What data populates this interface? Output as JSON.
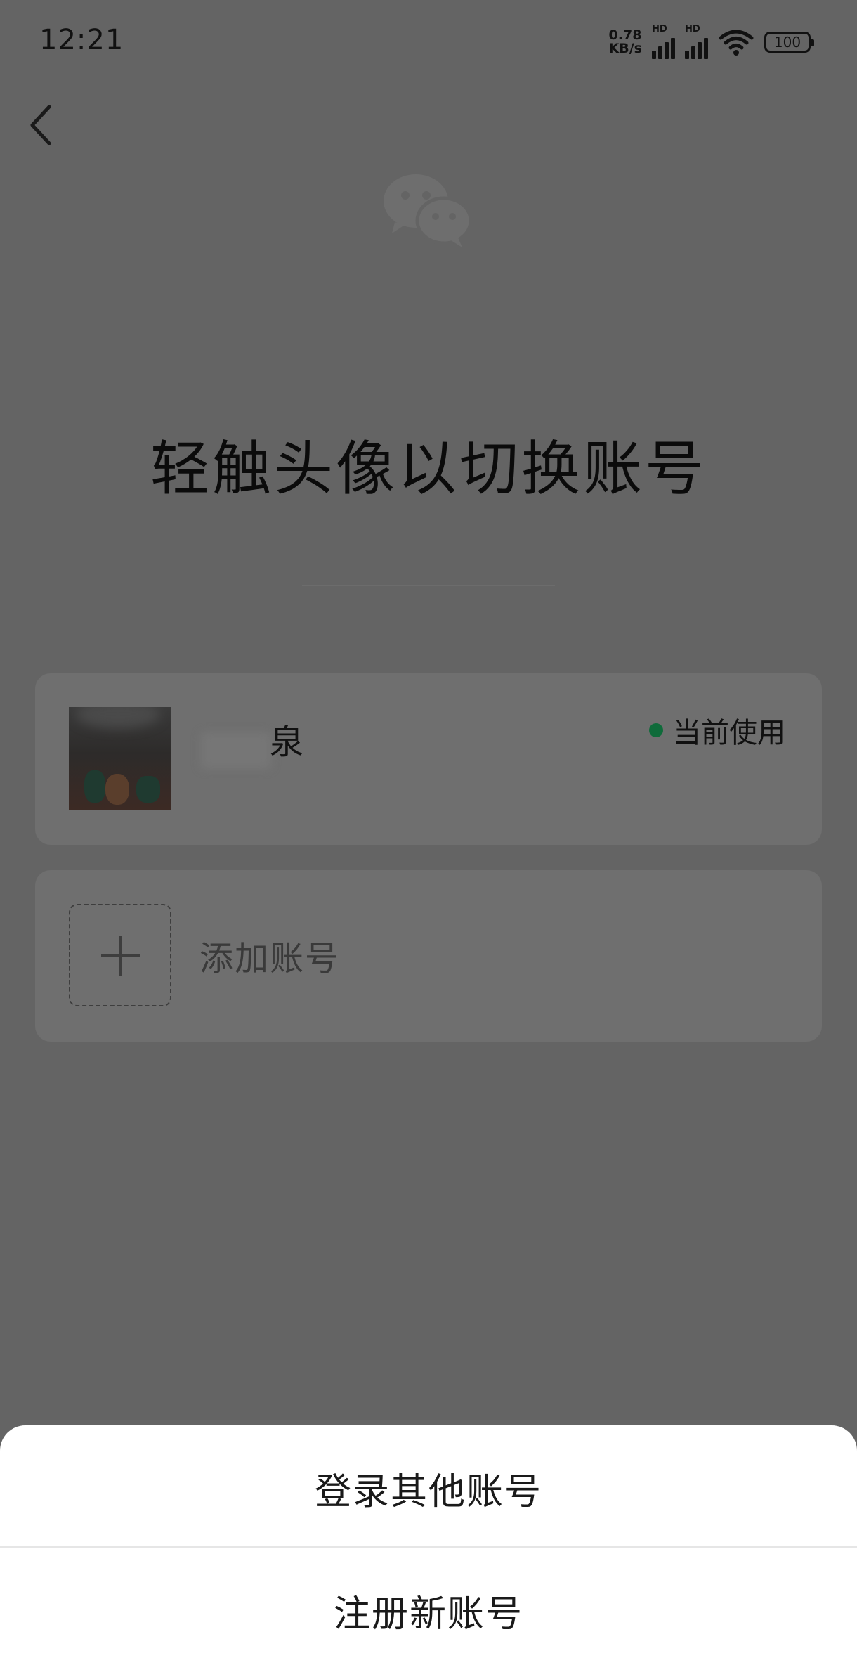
{
  "status_bar": {
    "time": "12:21",
    "net_speed_value": "0.78",
    "net_speed_unit": "KB/s",
    "signal1_label": "HD",
    "signal2_label": "HD",
    "battery": "100"
  },
  "header": {
    "back_icon": "chevron-left-icon",
    "logo_icon": "wechat-logo-icon"
  },
  "title": "轻触头像以切换账号",
  "accounts": [
    {
      "name": "泉",
      "status_label": "当前使用",
      "status_color": "#0f6b3a"
    }
  ],
  "add_account": {
    "label": "添加账号",
    "icon": "plus-icon"
  },
  "bottom_sheet": {
    "login_other": "登录其他账号",
    "register_new": "注册新账号"
  }
}
